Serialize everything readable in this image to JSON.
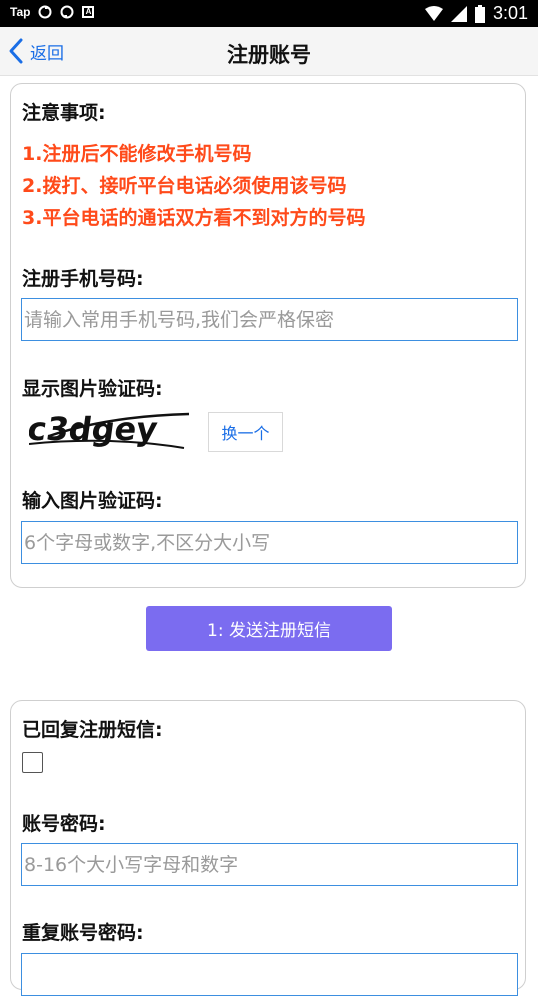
{
  "status_bar": {
    "left_text": "Tap",
    "a_badge": "A",
    "time": "3:01",
    "icons": [
      "sync-icon",
      "sync-icon",
      "a-badge-icon",
      "wifi-icon",
      "signal-icon",
      "battery-icon"
    ]
  },
  "header": {
    "back_label": "返回",
    "title": "注册账号"
  },
  "notice": {
    "title": "注意事项:",
    "lines": [
      "1.注册后不能修改手机号码",
      "2.拨打、接听平台电话必须使用该号码",
      "3.平台电话的通话双方看不到对方的号码"
    ],
    "color": "#ff4a1a"
  },
  "phone": {
    "label": "注册手机号码:",
    "placeholder": "请输入常用手机号码,我们会严格保密",
    "value": ""
  },
  "captcha": {
    "label": "显示图片验证码:",
    "image_text": "c3dgey",
    "refresh_label": "换一个"
  },
  "captcha_input": {
    "label": "输入图片验证码:",
    "placeholder": "6个字母或数字,不区分大小写",
    "value": ""
  },
  "send_button": {
    "label": "1:  发送注册短信",
    "color": "#7b6cf0"
  },
  "sms": {
    "label": "已回复注册短信:",
    "checked": false
  },
  "password": {
    "label": "账号密码:",
    "placeholder": "8-16个大小写字母和数字",
    "value": ""
  },
  "repeat_password": {
    "label": "重复账号密码:",
    "placeholder": "",
    "value": ""
  },
  "colors": {
    "accent_blue": "#1a6ee6",
    "input_border": "#3d8fe0"
  }
}
